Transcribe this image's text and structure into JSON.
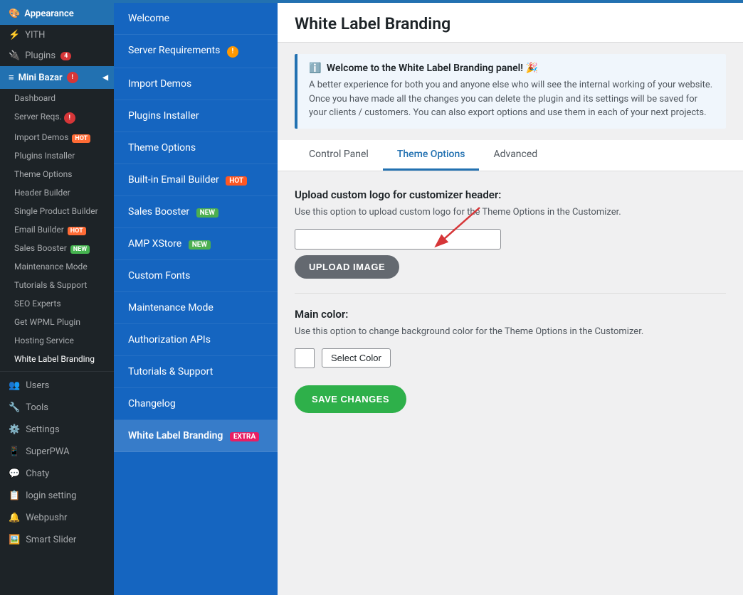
{
  "sidebar": {
    "title": "Appearance",
    "items": [
      {
        "label": "Appearance",
        "icon": "🎨",
        "active": false
      },
      {
        "label": "YITH",
        "icon": "⚡",
        "active": false
      },
      {
        "label": "Plugins",
        "icon": "🔌",
        "badge_count": "4",
        "active": false
      }
    ],
    "mini_bazar": "Mini Bazar",
    "sub_items": [
      {
        "label": "Dashboard",
        "active": false
      },
      {
        "label": "Server Reqs.",
        "badge": "exclamation",
        "active": false
      },
      {
        "label": "Import Demos",
        "badge": "hot",
        "active": false
      },
      {
        "label": "Plugins Installer",
        "active": false
      },
      {
        "label": "Theme Options",
        "active": false
      },
      {
        "label": "Header Builder",
        "active": false
      },
      {
        "label": "Single Product Builder",
        "active": false
      },
      {
        "label": "Email Builder",
        "badge": "hot",
        "active": false
      },
      {
        "label": "Sales Booster",
        "badge": "new",
        "active": false
      },
      {
        "label": "Maintenance Mode",
        "active": false
      },
      {
        "label": "Tutorials & Support",
        "active": false
      },
      {
        "label": "SEO Experts",
        "active": false
      },
      {
        "label": "Get WPML Plugin",
        "active": false
      },
      {
        "label": "Hosting Service",
        "active": false
      },
      {
        "label": "White Label Branding",
        "active": true
      }
    ],
    "bottom_items": [
      {
        "label": "Users",
        "icon": "👥"
      },
      {
        "label": "Tools",
        "icon": "🔧"
      },
      {
        "label": "Settings",
        "icon": "⚙️"
      },
      {
        "label": "SuperPWA",
        "icon": "📱"
      },
      {
        "label": "Chaty",
        "icon": "💬"
      },
      {
        "label": "login setting",
        "icon": "📋"
      },
      {
        "label": "Webpushr",
        "icon": "🔔"
      },
      {
        "label": "Smart Slider",
        "icon": "🖼️"
      }
    ]
  },
  "middle": {
    "items": [
      {
        "label": "Welcome",
        "active": false
      },
      {
        "label": "Server Requirements",
        "badge": "exclamation",
        "active": false
      },
      {
        "label": "Import Demos",
        "active": false
      },
      {
        "label": "Plugins Installer",
        "active": false
      },
      {
        "label": "Theme Options",
        "active": false
      },
      {
        "label": "Built-in Email Builder",
        "badge": "hot",
        "active": false
      },
      {
        "label": "Sales Booster",
        "badge": "new",
        "active": false
      },
      {
        "label": "AMP XStore",
        "badge": "new",
        "active": false
      },
      {
        "label": "Custom Fonts",
        "active": false
      },
      {
        "label": "Maintenance Mode",
        "active": false
      },
      {
        "label": "Authorization APIs",
        "active": false
      },
      {
        "label": "Tutorials & Support",
        "active": false
      },
      {
        "label": "Changelog",
        "active": false
      },
      {
        "label": "White Label Branding",
        "badge": "extra",
        "active": true
      }
    ]
  },
  "main": {
    "title": "White Label Branding",
    "notice": {
      "title": "Welcome to the White Label Branding panel! 🎉",
      "text": "A better experience for both you and anyone else who will see the internal working of your website. Once you have made all the changes you can delete the plugin and its settings will be saved for your clients / customers. You can also export options and use them in each of your next projects."
    },
    "tabs": [
      {
        "label": "Control Panel",
        "active": false
      },
      {
        "label": "Theme Options",
        "active": true
      },
      {
        "label": "Advanced",
        "active": false
      }
    ],
    "upload_section": {
      "title": "Upload custom logo for customizer header:",
      "desc": "Use this option to upload custom logo for the Theme Options in the Customizer.",
      "input_placeholder": "",
      "upload_btn_label": "UPLOAD IMAGE"
    },
    "color_section": {
      "title": "Main color:",
      "desc": "Use this option to change background color for the Theme Options in the Customizer.",
      "select_color_label": "Select Color"
    },
    "save_btn_label": "SAVE CHANGES"
  }
}
